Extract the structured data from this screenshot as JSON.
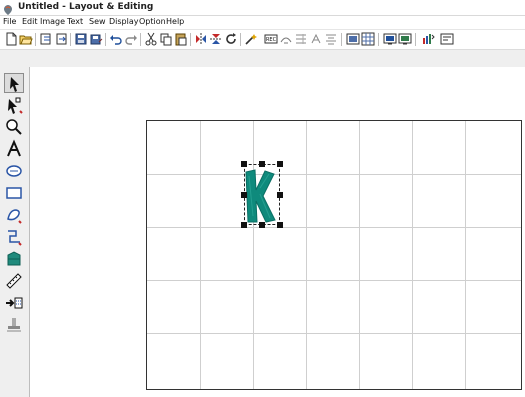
{
  "window": {
    "title": "Untitled - Layout & Editing",
    "icon": "app-icon"
  },
  "menu": {
    "items": [
      "File",
      "Edit",
      "Image",
      "Text",
      "Sew",
      "Display",
      "Option",
      "Help"
    ]
  },
  "toolbar": {
    "buttons": [
      {
        "name": "new-icon"
      },
      {
        "name": "open-icon"
      },
      {
        "name": "import-icon"
      },
      {
        "name": "export-icon"
      },
      {
        "name": "save-icon"
      },
      {
        "name": "save-as-icon"
      },
      {
        "name": "undo-icon"
      },
      {
        "name": "redo-icon"
      },
      {
        "name": "cut-icon"
      },
      {
        "name": "copy-icon"
      },
      {
        "name": "paste-icon"
      },
      {
        "name": "flip-horizontal-icon"
      },
      {
        "name": "flip-vertical-icon"
      },
      {
        "name": "rotate-icon"
      },
      {
        "name": "wizard-icon"
      },
      {
        "name": "record-icon",
        "label": "REC"
      },
      {
        "name": "text-arc-icon"
      },
      {
        "name": "text-layout-icon"
      },
      {
        "name": "text-attributes-icon"
      },
      {
        "name": "align-icon"
      },
      {
        "name": "sewing-attributes-icon"
      },
      {
        "name": "grid-icon"
      },
      {
        "name": "preview-icon"
      },
      {
        "name": "realistic-preview-icon"
      },
      {
        "name": "sew-order-icon"
      },
      {
        "name": "design-property-icon"
      }
    ]
  },
  "tools": [
    {
      "name": "select-tool-icon"
    },
    {
      "name": "point-edit-tool-icon"
    },
    {
      "name": "zoom-tool-icon"
    },
    {
      "name": "text-tool-icon"
    },
    {
      "name": "shape-tool-icon"
    },
    {
      "name": "rectangle-tool-icon"
    },
    {
      "name": "brush-tool-icon"
    },
    {
      "name": "stitch-tool-icon"
    },
    {
      "name": "shape-library-icon"
    },
    {
      "name": "measure-tool-icon"
    },
    {
      "name": "import-stitch-icon"
    },
    {
      "name": "stamp-tool-icon"
    }
  ],
  "design": {
    "letter": "K",
    "letter_color": "#0f8a7c",
    "handle_color": "#111111"
  },
  "colors": {
    "toolbar_bg": "#ffffff",
    "ribbon_bg": "#efefef",
    "grid_line": "#cfcfcf"
  }
}
